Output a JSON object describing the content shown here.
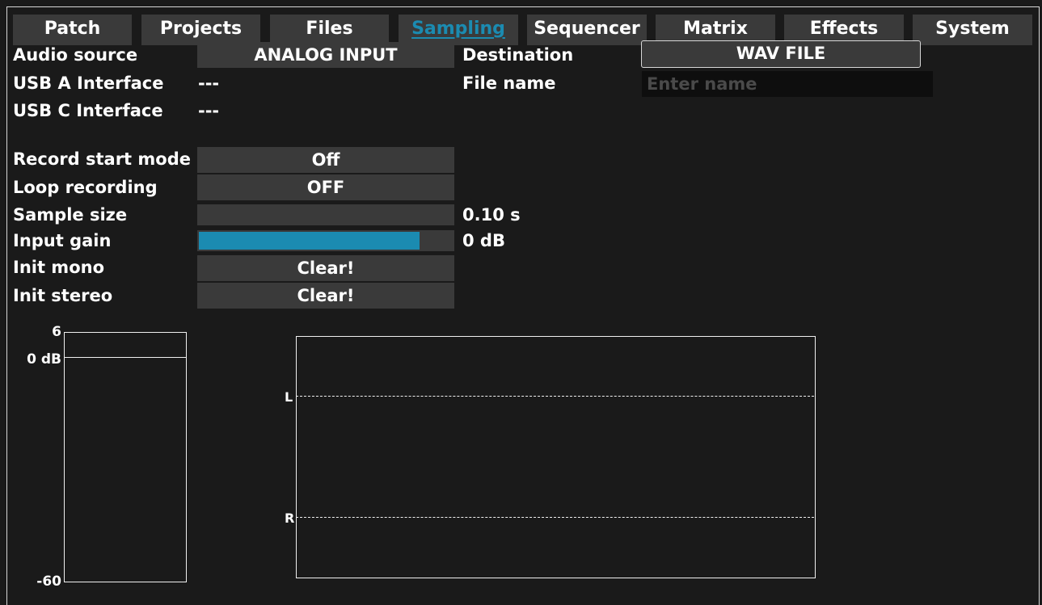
{
  "tabs": [
    {
      "label": "Patch"
    },
    {
      "label": "Projects"
    },
    {
      "label": "Files"
    },
    {
      "label": "Sampling"
    },
    {
      "label": "Sequencer"
    },
    {
      "label": "Matrix"
    },
    {
      "label": "Effects"
    },
    {
      "label": "System"
    }
  ],
  "active_tab": "Sampling",
  "colors": {
    "accent": "#1b8bb1",
    "background": "#1a1a1a",
    "control": "#3a3a3a"
  },
  "source": {
    "audio_source_label": "Audio source",
    "audio_source_value": "ANALOG INPUT",
    "usb_a_label": "USB A Interface",
    "usb_a_value": "---",
    "usb_c_label": "USB C Interface",
    "usb_c_value": "---"
  },
  "destination": {
    "label": "Destination",
    "value": "WAV FILE",
    "file_name_label": "File name",
    "file_name_value": "",
    "file_name_placeholder": "Enter name"
  },
  "settings": {
    "record_start_mode_label": "Record start mode",
    "record_start_mode_value": "Off",
    "loop_recording_label": "Loop recording",
    "loop_recording_value": "OFF",
    "sample_size_label": "Sample size",
    "sample_size_value": "0.10 s",
    "sample_size_fraction": 0,
    "input_gain_label": "Input gain",
    "input_gain_value": "0 dB",
    "input_gain_fraction": 0.87,
    "init_mono_label": "Init mono",
    "init_mono_button": "Clear!",
    "init_stereo_label": "Init stereo",
    "init_stereo_button": "Clear!"
  },
  "level_meter": {
    "top_label": "6",
    "zero_label": "0 dB",
    "bottom_label": "-60"
  },
  "waveform": {
    "left_label": "L",
    "right_label": "R"
  }
}
